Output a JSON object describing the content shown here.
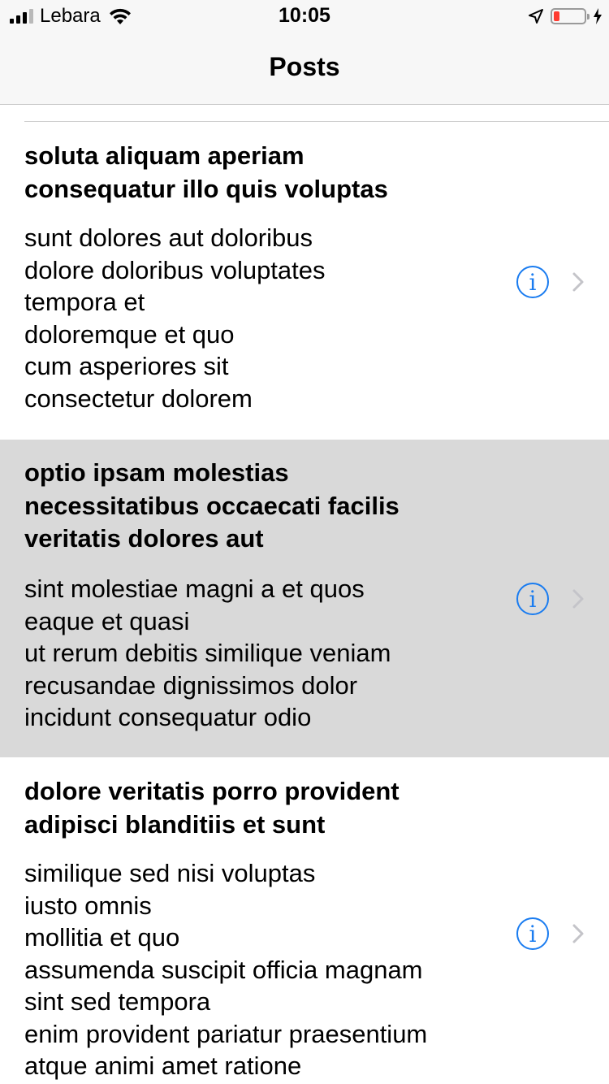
{
  "status_bar": {
    "carrier": "Lebara",
    "time": "10:05",
    "battery_level": 0.2,
    "battery_color": "#ff3b30"
  },
  "nav": {
    "title": "Posts"
  },
  "accent_color": "#1a7cf0",
  "posts": [
    {
      "title": [
        "soluta aliquam aperiam",
        "consequatur illo quis voluptas"
      ],
      "body": [
        "sunt dolores aut doloribus",
        "dolore doloribus voluptates",
        "tempora et",
        "doloremque et quo",
        "cum asperiores sit",
        "consectetur dolorem"
      ],
      "info_icon": "info-icon",
      "selected": false
    },
    {
      "title": [
        "optio ipsam molestias",
        "necessitatibus occaecati facilis",
        "veritatis dolores aut"
      ],
      "body": [
        "sint molestiae magni a et quos",
        "eaque et quasi",
        "ut rerum debitis similique veniam",
        "recusandae dignissimos dolor",
        "incidunt consequatur odio"
      ],
      "info_icon": "info-icon",
      "selected": true
    },
    {
      "title": [
        "dolore veritatis porro provident",
        "adipisci blanditiis et sunt"
      ],
      "body": [
        "similique sed nisi voluptas",
        "iusto omnis",
        "mollitia et quo",
        "assumenda suscipit officia magnam",
        "sint sed tempora",
        "enim provident pariatur praesentium",
        "atque animi amet ratione"
      ],
      "info_icon": "info-icon",
      "selected": false
    }
  ]
}
